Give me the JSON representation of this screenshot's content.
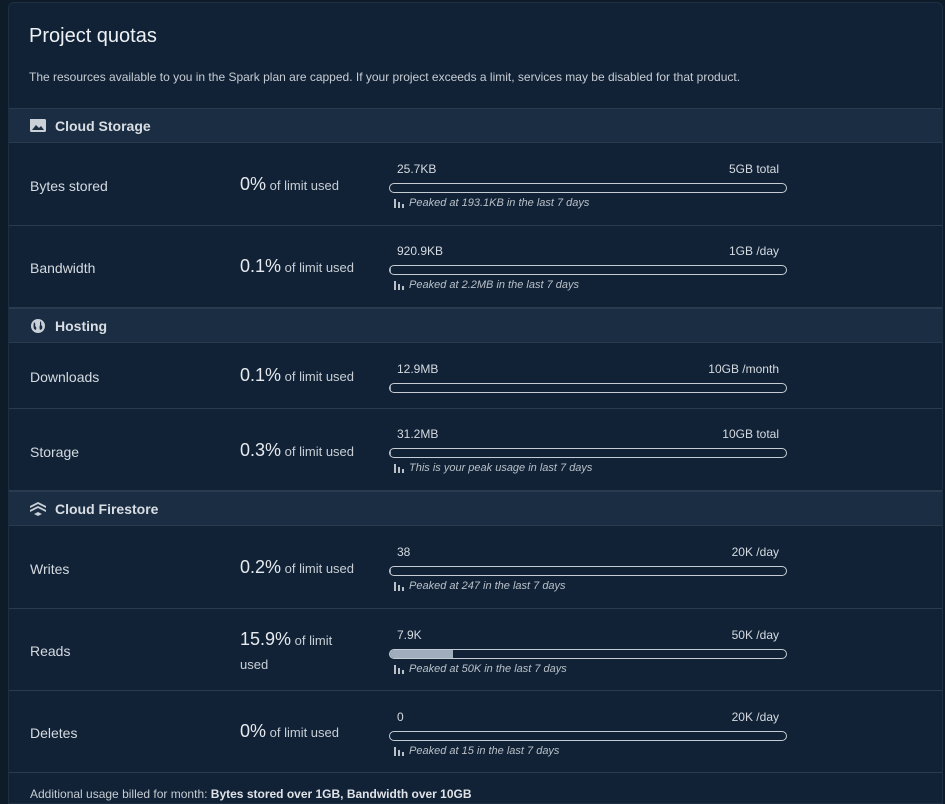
{
  "card": {
    "title": "Project quotas",
    "description": "The resources available to you in the Spark plan are capped. If your project exceeds a limit, services may be disabled for that product."
  },
  "sections": [
    {
      "title": "Cloud Storage",
      "icon": "image-folder-icon",
      "rows": [
        {
          "label": "Bytes stored",
          "percent": "0%",
          "suffix": "of limit used",
          "used": "25.7KB",
          "limit": "5GB total",
          "fill": 0.0,
          "peak": "Peaked at 193.1KB in the last 7 days"
        },
        {
          "label": "Bandwidth",
          "percent": "0.1%",
          "suffix": "of limit used",
          "used": "920.9KB",
          "limit": "1GB /day",
          "fill": 0.001,
          "peak": "Peaked at 2.2MB in the last 7 days"
        }
      ]
    },
    {
      "title": "Hosting",
      "icon": "globe-icon",
      "rows": [
        {
          "label": "Downloads",
          "percent": "0.1%",
          "suffix": "of limit used",
          "used": "12.9MB",
          "limit": "10GB /month",
          "fill": 0.001,
          "peak": ""
        },
        {
          "label": "Storage",
          "percent": "0.3%",
          "suffix": "of limit used",
          "used": "31.2MB",
          "limit": "10GB total",
          "fill": 0.003,
          "peak": "This is your peak usage in last 7 days"
        }
      ]
    },
    {
      "title": "Cloud Firestore",
      "icon": "firestore-icon",
      "rows": [
        {
          "label": "Writes",
          "percent": "0.2%",
          "suffix": "of limit used",
          "used": "38",
          "limit": "20K /day",
          "fill": 0.002,
          "peak": "Peaked at 247 in the last 7 days"
        },
        {
          "label": "Reads",
          "percent": "15.9%",
          "suffix": "of limit used",
          "used": "7.9K",
          "limit": "50K /day",
          "fill": 0.159,
          "peak": "Peaked at 50K in the last 7 days"
        },
        {
          "label": "Deletes",
          "percent": "0%",
          "suffix": "of limit used",
          "used": "0",
          "limit": "20K /day",
          "fill": 0.0,
          "peak": "Peaked at 15 in the last 7 days"
        }
      ]
    }
  ],
  "footer": {
    "prefix": "Additional usage billed for month:",
    "items": "Bytes stored over 1GB, Bandwidth over 10GB"
  },
  "colors": {
    "background": "#0e1b29",
    "card": "#112236",
    "section_header": "#1a2d42",
    "bar_fill": "#9fadbc"
  }
}
